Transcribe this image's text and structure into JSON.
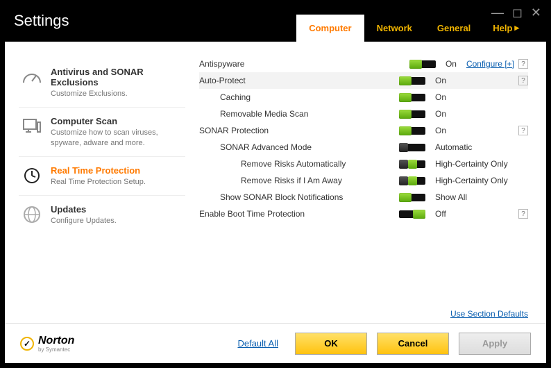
{
  "title": "Settings",
  "tabs": {
    "computer": "Computer",
    "network": "Network",
    "general": "General",
    "help": "Help"
  },
  "sidebar": [
    {
      "title": "Antivirus and SONAR Exclusions",
      "desc": "Customize Exclusions."
    },
    {
      "title": "Computer Scan",
      "desc": "Customize how to scan viruses, spyware, adware and more."
    },
    {
      "title": "Real Time Protection",
      "desc": "Real Time Protection Setup."
    },
    {
      "title": "Updates",
      "desc": "Configure Updates."
    }
  ],
  "settings": {
    "antispyware": {
      "label": "Antispyware",
      "value": "On",
      "link": "Configure [+]"
    },
    "autoprotect": {
      "label": "Auto-Protect",
      "value": "On"
    },
    "caching": {
      "label": "Caching",
      "value": "On"
    },
    "removable": {
      "label": "Removable Media Scan",
      "value": "On"
    },
    "sonar": {
      "label": "SONAR Protection",
      "value": "On"
    },
    "sonar_adv": {
      "label": "SONAR Advanced Mode",
      "value": "Automatic"
    },
    "remove_auto": {
      "label": "Remove Risks Automatically",
      "value": "High-Certainty Only"
    },
    "remove_away": {
      "label": "Remove Risks if I Am Away",
      "value": "High-Certainty Only"
    },
    "show_block": {
      "label": "Show SONAR Block Notifications",
      "value": "Show All"
    },
    "boot": {
      "label": "Enable Boot Time Protection",
      "value": "Off"
    }
  },
  "links": {
    "section_defaults": "Use Section Defaults",
    "default_all": "Default All"
  },
  "buttons": {
    "ok": "OK",
    "cancel": "Cancel",
    "apply": "Apply"
  },
  "brand": {
    "name": "Norton",
    "sub": "by Symantec"
  }
}
